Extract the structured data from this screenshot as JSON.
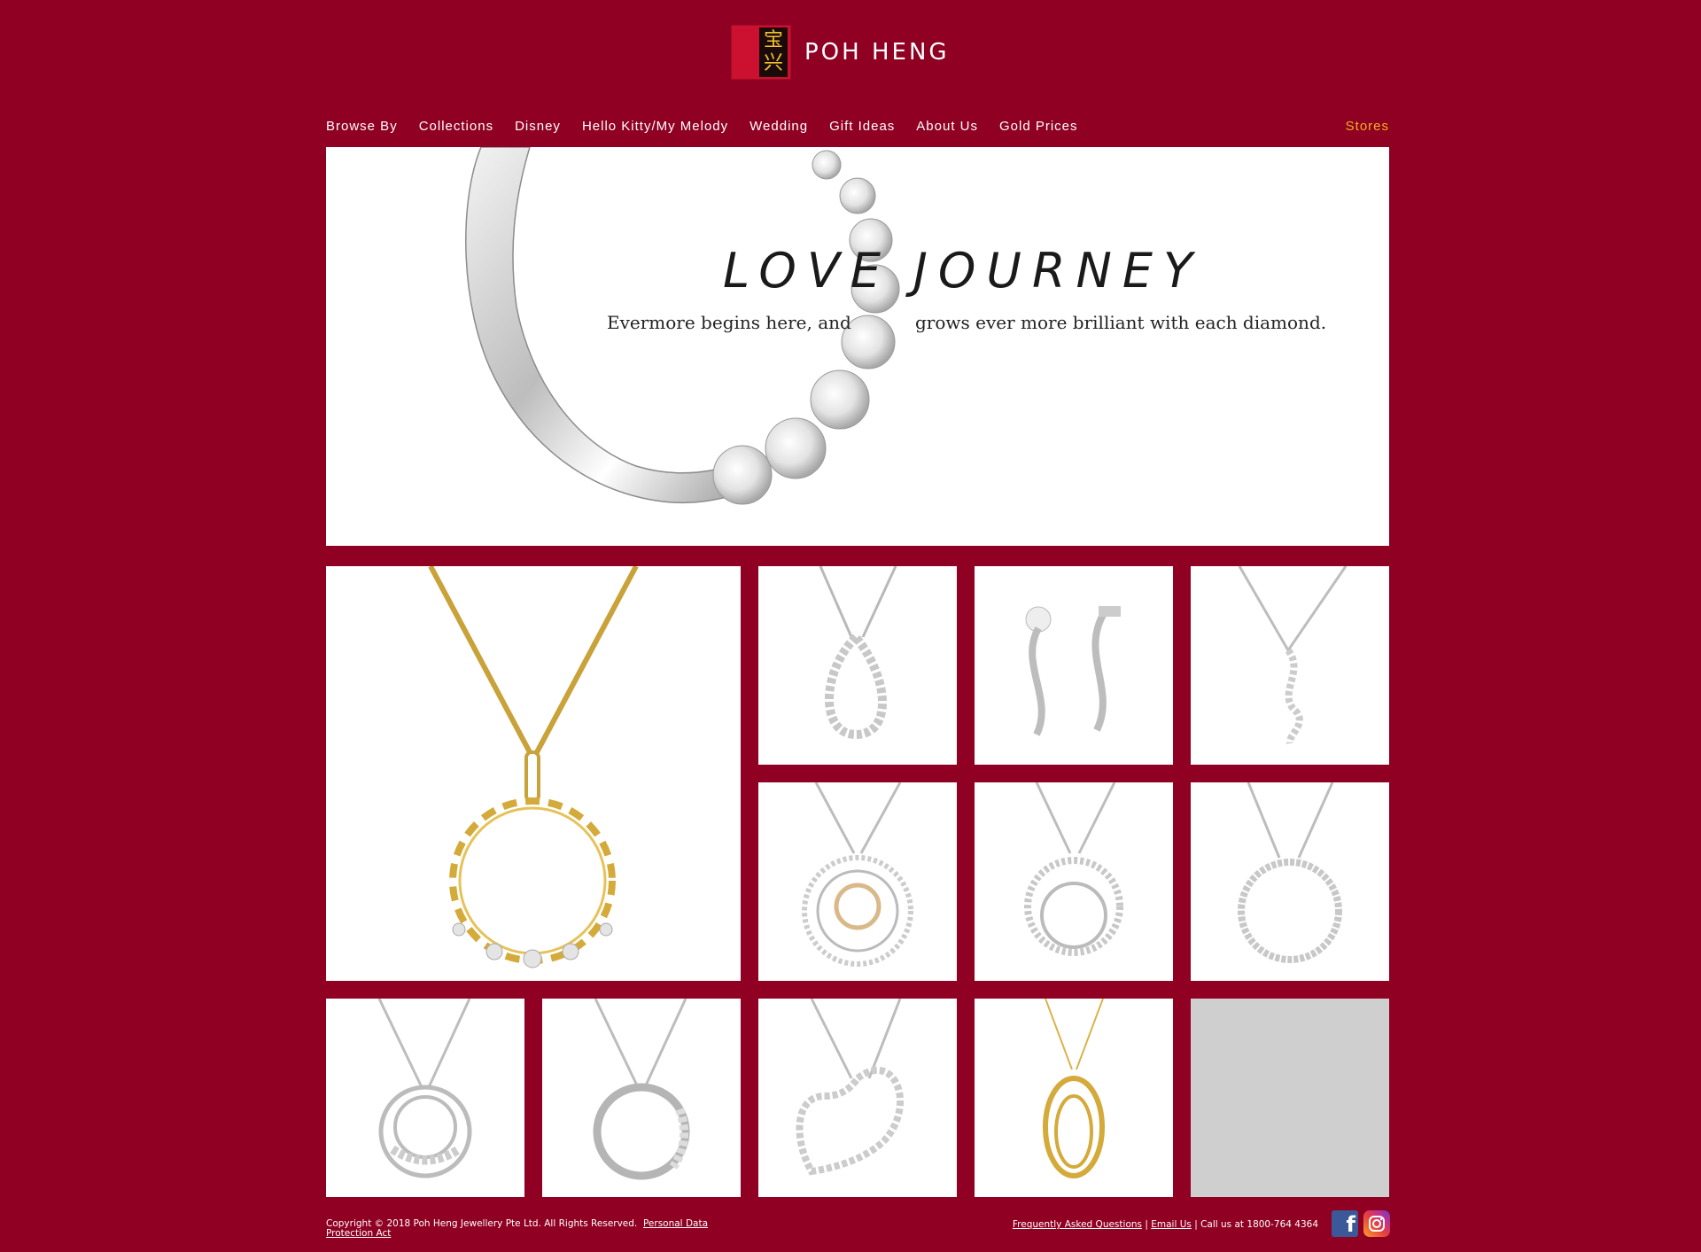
{
  "brand": {
    "name": "POH HENG",
    "logo_chars": [
      "宝",
      "兴"
    ]
  },
  "nav": {
    "items": [
      "Browse By",
      "Collections",
      "Disney",
      "Hello Kitty/My Melody",
      "Wedding",
      "Gift Ideas",
      "About Us",
      "Gold Prices"
    ],
    "stores": "Stores"
  },
  "hero": {
    "title_word1": "LOVE",
    "title_word2": "JOURNEY",
    "subtitle_part1": "Evermore begins here, and",
    "subtitle_part2": "grows ever more brilliant with each diamond."
  },
  "footer": {
    "copyright": "Copyright © 2018 Poh Heng Jewellery Pte Ltd. All Rights Reserved.",
    "pdpa_link": "Personal Data Protection Act",
    "faq_link": "Frequently Asked Questions",
    "email_link": "Email Us",
    "call_text": "Call us at 1800-764 4364",
    "separator": "|"
  },
  "social": {
    "facebook_label": "f",
    "icons": [
      "facebook-icon",
      "instagram-icon"
    ]
  },
  "colors": {
    "background": "#8f0023",
    "accent": "#f1b31c",
    "logo_red": "#cc1130",
    "gold": "#d4aa3a"
  }
}
